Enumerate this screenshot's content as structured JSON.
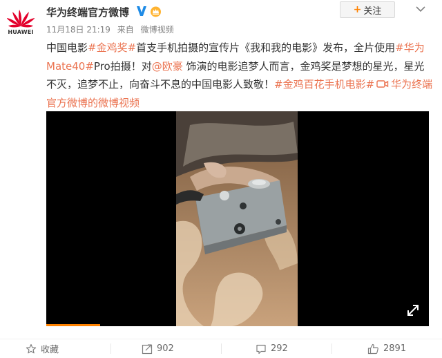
{
  "header": {
    "brand_logo_text": "HUAWEI",
    "user_name": "华为终端官方微博",
    "follow_label": "关注",
    "meta": {
      "date": "11月18日 21:19",
      "source_prefix": "来自",
      "source": "微博视频"
    }
  },
  "post": {
    "t1": "中国电影",
    "tag1": "#金鸡奖#",
    "t2": "首支手机拍摄的宣传片《我和我的电影》发布，全片使用",
    "tag2": "#华为Mate40#",
    "t3": "Pro拍摄！对",
    "mention": "@欧豪",
    "t4": " 饰演的电影追梦人而言，金鸡奖是梦想的星光，星光不灭，追梦不止，向奋斗不息的中国电影人致敬！",
    "tag3": "#金鸡百花手机电影#",
    "video_link": "华为终端官方微博的微博视频"
  },
  "video": {
    "progress_fraction": 0.14
  },
  "actions": {
    "favorite_label": "收藏",
    "repost_count": "902",
    "comment_count": "292",
    "like_count": "2891"
  },
  "colors": {
    "accent": "#eb7350",
    "brand_red": "#e3002b",
    "orange": "#ff8200"
  }
}
